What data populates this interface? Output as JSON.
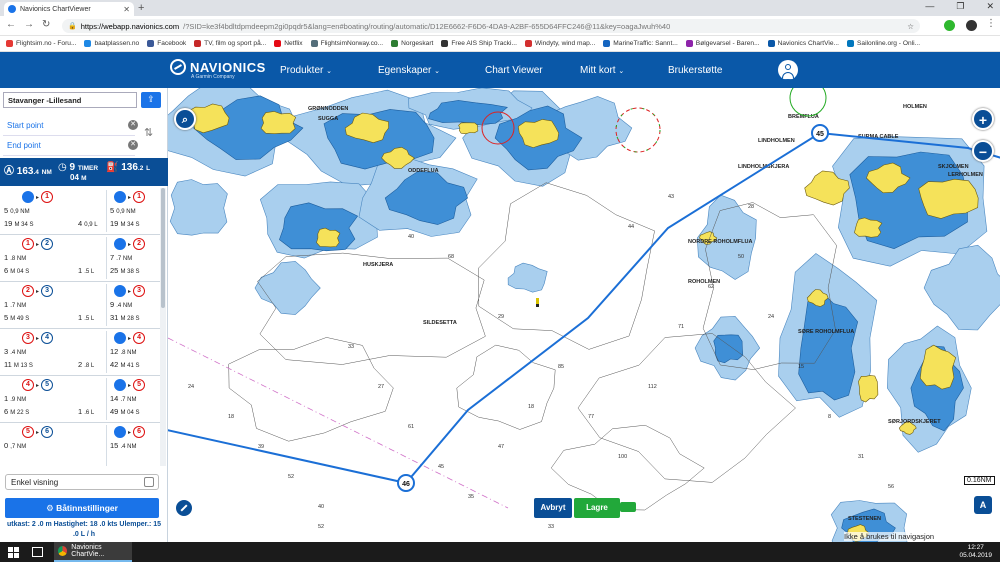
{
  "browser": {
    "tab_title": "Navionics ChartViewer",
    "url_host": "https://webapp.navionics.com",
    "url_path": "/?SID=ke3f4bdltdpmdeepm2gi0pqdr5&lang=en#boating/routing/automatic/D12E6662-F6D6-4DA9-A2BF-655D64FFC246@11&key=oagaJwuh%40",
    "bookmarks": [
      {
        "label": "Flightsim.no - Foru...",
        "color": "#e53935"
      },
      {
        "label": "baatplassen.no",
        "color": "#1e88e5"
      },
      {
        "label": "Facebook",
        "color": "#3b5998"
      },
      {
        "label": "TV, film og sport på...",
        "color": "#c62828"
      },
      {
        "label": "Netflix",
        "color": "#e50914"
      },
      {
        "label": "FlightsimNorway.co...",
        "color": "#546e7a"
      },
      {
        "label": "Norgeskart",
        "color": "#2e7d32"
      },
      {
        "label": "Free AIS Ship Tracki...",
        "color": "#333333"
      },
      {
        "label": "Windyty, wind map...",
        "color": "#d32f2f"
      },
      {
        "label": "MarineTraffic: Sannt...",
        "color": "#1565c0"
      },
      {
        "label": "Bølgevarsel - Baren...",
        "color": "#8e24aa"
      },
      {
        "label": "Navionics ChartVie...",
        "color": "#0a58a8"
      },
      {
        "label": "Sailonline.org - Onli...",
        "color": "#0277bd"
      }
    ]
  },
  "header": {
    "logo_text": "NAVIONICS",
    "logo_sub": "A Garmin Company",
    "nav": [
      {
        "label": "Produkter",
        "dropdown": true
      },
      {
        "label": "Egenskaper",
        "dropdown": true
      },
      {
        "label": "Chart Viewer",
        "dropdown": false
      },
      {
        "label": "Mitt kort",
        "dropdown": true
      },
      {
        "label": "Brukerstøtte",
        "dropdown": false
      }
    ]
  },
  "sidebar": {
    "route_name": "Stavanger -Lillesand",
    "start_point": "Start point",
    "end_point": "End point",
    "summary": {
      "distance": "163",
      "distance_dec": ".4",
      "distance_unit": "NM",
      "time_h": "9",
      "time_h_unit": "TIMER",
      "time_m": "04",
      "time_m_unit": "M",
      "fuel": "136",
      "fuel_dec": ".2",
      "fuel_unit": "L"
    },
    "legs": [
      {
        "from": "",
        "to": "1",
        "dist": "5",
        "dist_sub": "0,9 NM",
        "time": "19",
        "time_sub": "M 34 S",
        "fuel": "4",
        "fuel_sub": "0,9 L",
        "r_dist": "5",
        "r_dist_sub": "0,9 NM",
        "r_time": "19",
        "r_time_sub": "M 34 S"
      },
      {
        "from": "1",
        "to": "2",
        "dist": "1",
        "dist_sub": ".8 NM",
        "time": "6",
        "time_sub": "M 04 S",
        "fuel": "1",
        "fuel_sub": ".5 L",
        "r_dist": "7",
        "r_dist_sub": ".7 NM",
        "r_time": "25",
        "r_time_sub": "M 38 S"
      },
      {
        "from": "2",
        "to": "3",
        "dist": "1",
        "dist_sub": ".7 NM",
        "time": "5",
        "time_sub": "M 49 S",
        "fuel": "1",
        "fuel_sub": ".5 L",
        "r_dist": "9",
        "r_dist_sub": ".4 NM",
        "r_time": "31",
        "r_time_sub": "M 28 S"
      },
      {
        "from": "3",
        "to": "4",
        "dist": "3",
        "dist_sub": ".4 NM",
        "time": "11",
        "time_sub": "M 13 S",
        "fuel": "2",
        "fuel_sub": ".8 L",
        "r_dist": "12",
        "r_dist_sub": ".8 NM",
        "r_time": "42",
        "r_time_sub": "M 41 S"
      },
      {
        "from": "4",
        "to": "5",
        "dist": "1",
        "dist_sub": ".9 NM",
        "time": "6",
        "time_sub": "M 22 S",
        "fuel": "1",
        "fuel_sub": ".6 L",
        "r_dist": "14",
        "r_dist_sub": ".7 NM",
        "r_time": "49",
        "r_time_sub": "M 04 S"
      },
      {
        "from": "5",
        "to": "6",
        "dist": "0",
        "dist_sub": ",7 NM",
        "time": "",
        "time_sub": "",
        "fuel": "",
        "fuel_sub": "",
        "r_dist": "15",
        "r_dist_sub": ".4 NM",
        "r_time": "",
        "r_time_sub": ""
      }
    ],
    "simple_view_label": "Enkel visning",
    "boat_settings_label": "Båtinnstillinger",
    "boat_params_line1": "utkast: 2 .0 m Hastighet: 18 .0 kts Ulemper.: 15",
    "boat_params_line2": ".0 L / h"
  },
  "map": {
    "waypoint_labels": [
      "45",
      "46"
    ],
    "cancel_label": "Avbryt",
    "save_label": "Lagre",
    "scale_label": "0.16NM",
    "hint_text": "Ikke å brukes til navigasjon",
    "place_labels": [
      "GRØNNODDEN",
      "SUGGA",
      "ODDEFLUA",
      "LINDHOLMEN",
      "LINDHOLMSKJERA",
      "NORDRE ROHOLMFLUA",
      "ROHOLMEN",
      "SØRE ROHOLMFLUA",
      "BREMFLUA",
      "HOLMEN",
      "SKJOLMEN",
      "LERHOLMEN",
      "SILDESETTA",
      "HUSKJERA",
      "STESTENEN",
      "SØRJORDSKJERET",
      "SURMA CABLE"
    ],
    "depths": [
      "24",
      "18",
      "39",
      "52",
      "40",
      "33",
      "27",
      "61",
      "45",
      "35",
      "47",
      "18",
      "85",
      "77",
      "100",
      "112",
      "71",
      "62",
      "50",
      "24",
      "15",
      "8",
      "31",
      "56",
      "29",
      "68",
      "40",
      "44",
      "43",
      "28",
      "19",
      "33",
      "52"
    ]
  },
  "taskbar": {
    "app_label": "Navionics ChartVie...",
    "time": "12:27",
    "date": "05.04.2019"
  }
}
